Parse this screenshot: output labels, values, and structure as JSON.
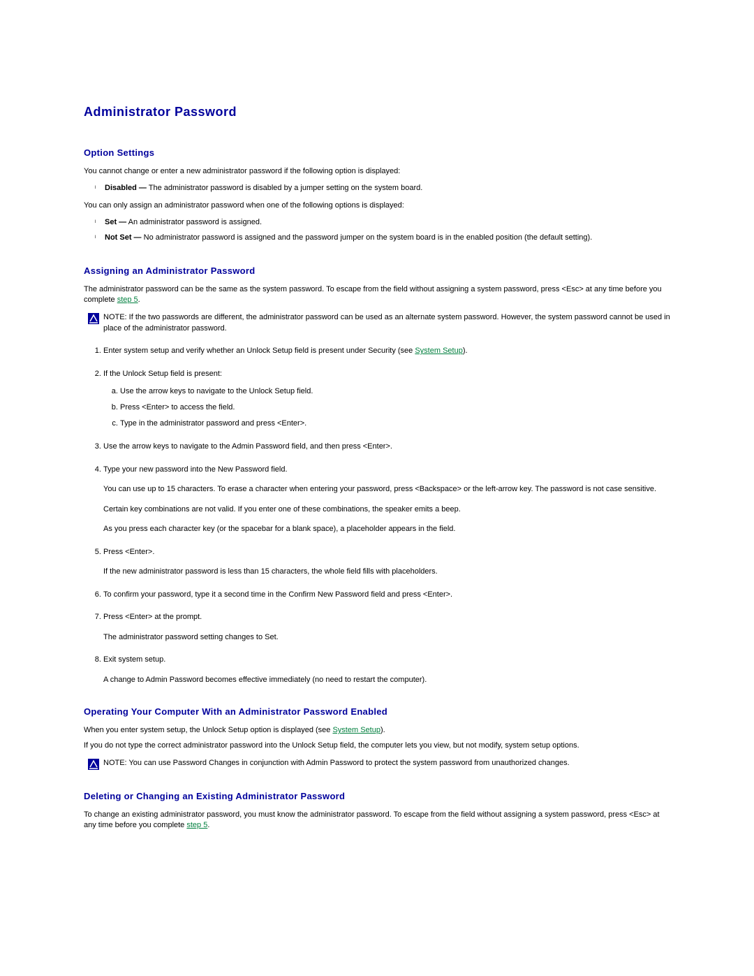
{
  "title": "Administrator Password",
  "sections": {
    "option_settings": {
      "heading": "Option Settings",
      "p1": "You cannot change or enter a new administrator password if the following option is displayed:",
      "bullets_a": [
        {
          "label": "Disabled —",
          "rest": " The administrator password is disabled by a jumper setting on the system board."
        }
      ],
      "p2": "You can only assign an administrator password when one of the following options is displayed:",
      "bullets_b": [
        {
          "label": "Set —",
          "rest": " An administrator password is assigned."
        },
        {
          "label": "Not Set —",
          "rest": " No administrator password is assigned and the password jumper on the system board is in the enabled position (the default setting)."
        }
      ]
    },
    "assigning": {
      "heading": "Assigning an Administrator Password",
      "intro_pre": "The administrator password can be the same as the system password. To escape from the field without assigning a system password, press <Esc> at any time before you complete ",
      "intro_link": "step 5",
      "intro_post": ".",
      "note1": "NOTE: If the two passwords are different, the administrator password can be used as an alternate system password. However, the system password cannot be used in place of the administrator password.",
      "steps": {
        "s1_pre": "Enter system setup and verify whether an Unlock Setup field is present under Security (see ",
        "s1_link": "System Setup",
        "s1_post": ").",
        "s2": "If the Unlock Setup field is present:",
        "s2a": "Use the arrow keys to navigate to the Unlock Setup field.",
        "s2b": "Press <Enter> to access the field.",
        "s2c": "Type in the administrator password and press <Enter>.",
        "s3": "Use the arrow keys to navigate to the Admin Password field, and then press <Enter>.",
        "s4": "Type your new password into the New Password field.",
        "s4_p1": "You can use up to 15 characters. To erase a character when entering your password, press <Backspace> or the left-arrow key. The password is not case sensitive.",
        "s4_p2": "Certain key combinations are not valid. If you enter one of these combinations, the speaker emits a beep.",
        "s4_p3": "As you press each character key (or the spacebar for a blank space), a placeholder appears in the field.",
        "s5": "Press <Enter>.",
        "s5_p1": "If the new administrator password is less than 15 characters, the whole field fills with placeholders.",
        "s6": "To confirm your password, type it a second time in the Confirm New Password field and press <Enter>.",
        "s7": "Press <Enter> at the prompt.",
        "s7_p1": "The administrator password setting changes to Set.",
        "s8": "Exit system setup.",
        "s8_p1": "A change to Admin Password becomes effective immediately (no need to restart the computer)."
      }
    },
    "operating": {
      "heading": "Operating Your Computer With an Administrator Password Enabled",
      "p1_pre": "When you enter system setup, the Unlock Setup option is displayed (see ",
      "p1_link": "System Setup",
      "p1_post": ").",
      "p2": "If you do not type the correct administrator password into the Unlock Setup field, the computer lets you view, but not modify, system setup options.",
      "note": "NOTE: You can use Password Changes in conjunction with Admin Password to protect the system password from unauthorized changes."
    },
    "deleting": {
      "heading": "Deleting or Changing an Existing Administrator Password",
      "p1_pre": "To change an existing administrator password, you must know the administrator password. To escape from the field without assigning a system password, press <Esc> at any time before you complete ",
      "p1_link": "step 5",
      "p1_post": "."
    }
  }
}
